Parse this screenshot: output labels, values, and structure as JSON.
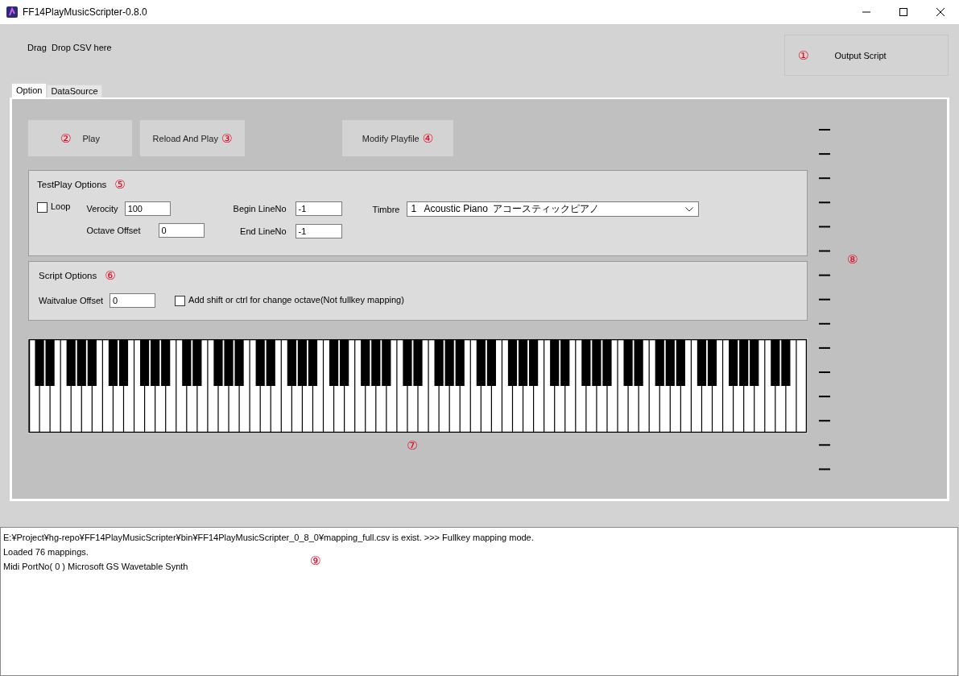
{
  "window": {
    "title": "FF14PlayMusicScripter-0.8.0"
  },
  "drop_label": "Drag  Drop CSV here",
  "output_button": {
    "label": "Output Script",
    "marker": "①"
  },
  "tabs": [
    {
      "label": "Option",
      "selected": true
    },
    {
      "label": "DataSource",
      "selected": false
    }
  ],
  "buttons": [
    {
      "label": "Play",
      "marker": "②",
      "kind": "marker_first"
    },
    {
      "label": "Reload And Play",
      "marker": "③",
      "kind": "marker_last"
    },
    {
      "label": "Modify Playfile",
      "marker": "④",
      "kind": "marker_last"
    }
  ],
  "testplay": {
    "title": "TestPlay Options",
    "marker": "⑤",
    "loop": {
      "label": "Loop",
      "checked": false
    },
    "velocity": {
      "label": "Verocity",
      "value": "100"
    },
    "octave_offset": {
      "label": "Octave Offset",
      "value": "0"
    },
    "begin_line": {
      "label": "Begin LineNo",
      "value": "-1"
    },
    "end_line": {
      "label": "End LineNo",
      "value": "-1"
    },
    "timbre": {
      "label": "Timbre",
      "value": "1   Acoustic Piano  アコースティックピアノ"
    }
  },
  "script_options": {
    "title": "Script Options",
    "marker": "⑥",
    "waitvalue_offset": {
      "label": "Waitvalue Offset",
      "value": "0"
    },
    "shift_ctrl": {
      "label": "Add shift or ctrl for change octave(Not fullkey mapping)",
      "checked": false
    }
  },
  "keyboard": {
    "marker": "⑦"
  },
  "slider": {
    "marker": "⑧"
  },
  "log": {
    "lines": [
      "E:¥Project¥hg-repo¥FF14PlayMusicScripter¥bin¥FF14PlayMusicScripter_0_8_0¥mapping_full.csv is exist. >>> Fullkey mapping mode.",
      "Loaded 76 mappings.",
      "Midi PortNo( 0 ) Microsoft GS Wavetable Synth"
    ],
    "marker": "⑨"
  }
}
